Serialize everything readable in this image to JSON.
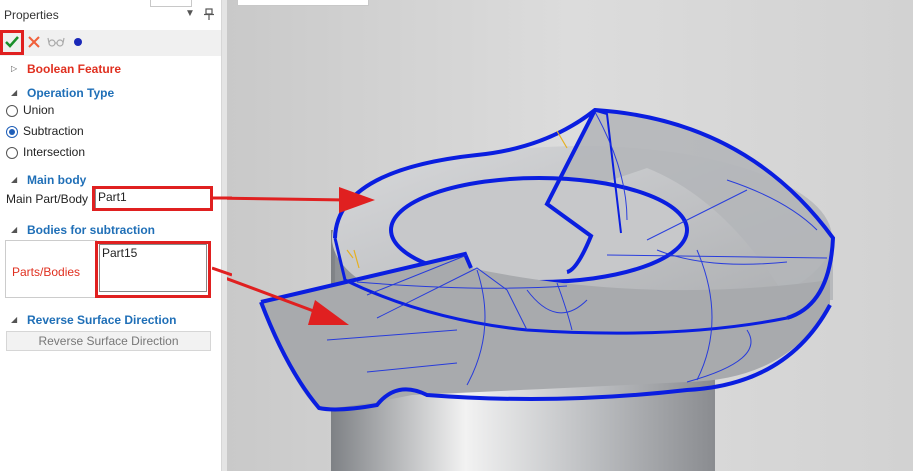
{
  "panel": {
    "title": "Properties",
    "collapse_icon": "chevron-down-icon",
    "pin_icon": "pin-icon",
    "toolbar": {
      "ok_icon": "checkmark-icon",
      "cancel_icon": "close-icon",
      "preview_icon": "preview-glasses-icon",
      "dot_icon": "dot-icon"
    },
    "sections": {
      "boolean_feature": "Boolean Feature",
      "operation_type": "Operation Type",
      "main_body": "Main body",
      "bodies_for_subtraction": "Bodies for subtraction",
      "reverse_surface_direction": "Reverse Surface Direction"
    },
    "operation_options": [
      {
        "label": "Union",
        "selected": false
      },
      {
        "label": "Subtraction",
        "selected": true
      },
      {
        "label": "Intersection",
        "selected": false
      }
    ],
    "main_part_label": "Main Part/Body",
    "main_part_value": "Part1",
    "parts_bodies_label": "Parts/Bodies",
    "parts_bodies_value": "Part15",
    "reverse_button_label": "Reverse Surface Direction"
  },
  "colors": {
    "accent_blue": "#1f6fb7",
    "highlight_red": "#e02020",
    "edge_blue": "#0a1ee0",
    "selected_radio": "#1e5eb8"
  }
}
